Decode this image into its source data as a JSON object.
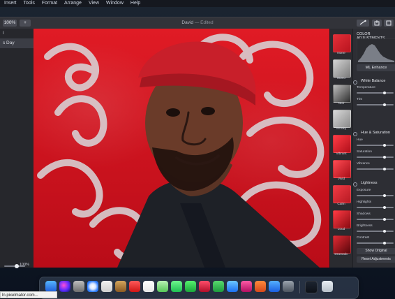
{
  "menubar": {
    "items": [
      "Insert",
      "Tools",
      "Format",
      "Arrange",
      "View",
      "Window",
      "Help"
    ]
  },
  "toolbar": {
    "zoom_label": "100%",
    "add_label": "+",
    "doc_title": "David",
    "doc_status": "— Edited"
  },
  "sidebar": {
    "items": [
      {
        "label": "l"
      },
      {
        "label": "s Day"
      }
    ],
    "zoom_value": 100,
    "zoom_value_label": "100%"
  },
  "right_panel": {
    "header": "COLOR ADJUSTMENTS",
    "ml_enhance_label": "ML Enhance",
    "presets": [
      "None",
      "Mono",
      "Noir",
      "Smoky",
      "Vibrant",
      "Vivid",
      "Calm",
      "Loud",
      "Dramatic"
    ],
    "sections": [
      {
        "title": "White Balance",
        "sliders": [
          "Temperature",
          "Tint"
        ]
      },
      {
        "title": "Hue & Saturation",
        "sliders": [
          "Hue",
          "Saturation",
          "Vibrance"
        ]
      },
      {
        "title": "Lightness",
        "sliders": [
          "Exposure",
          "Highlights",
          "Shadows",
          "Brightness",
          "Contrast"
        ]
      }
    ],
    "footer_buttons": [
      "Show Original",
      "Reset Adjustments"
    ]
  },
  "status_text": "ln.pixelmator.com...",
  "colors": {
    "canvas_red": "#d11b24",
    "panel_bg": "#2d2e34",
    "toolbar_bg": "#323339"
  },
  "icons": [
    "finder-icon",
    "siri-icon",
    "launchpad-icon",
    "safari-icon",
    "photos-icon",
    "notes-icon",
    "calendar-icon",
    "reminders-icon",
    "maps-icon",
    "messages-icon",
    "facetime-icon",
    "photo-booth-icon",
    "numbers-icon",
    "keynote-icon",
    "music-icon",
    "books-icon",
    "app-store-icon",
    "system-preferences-icon",
    "folder-icon",
    "trash-icon"
  ]
}
